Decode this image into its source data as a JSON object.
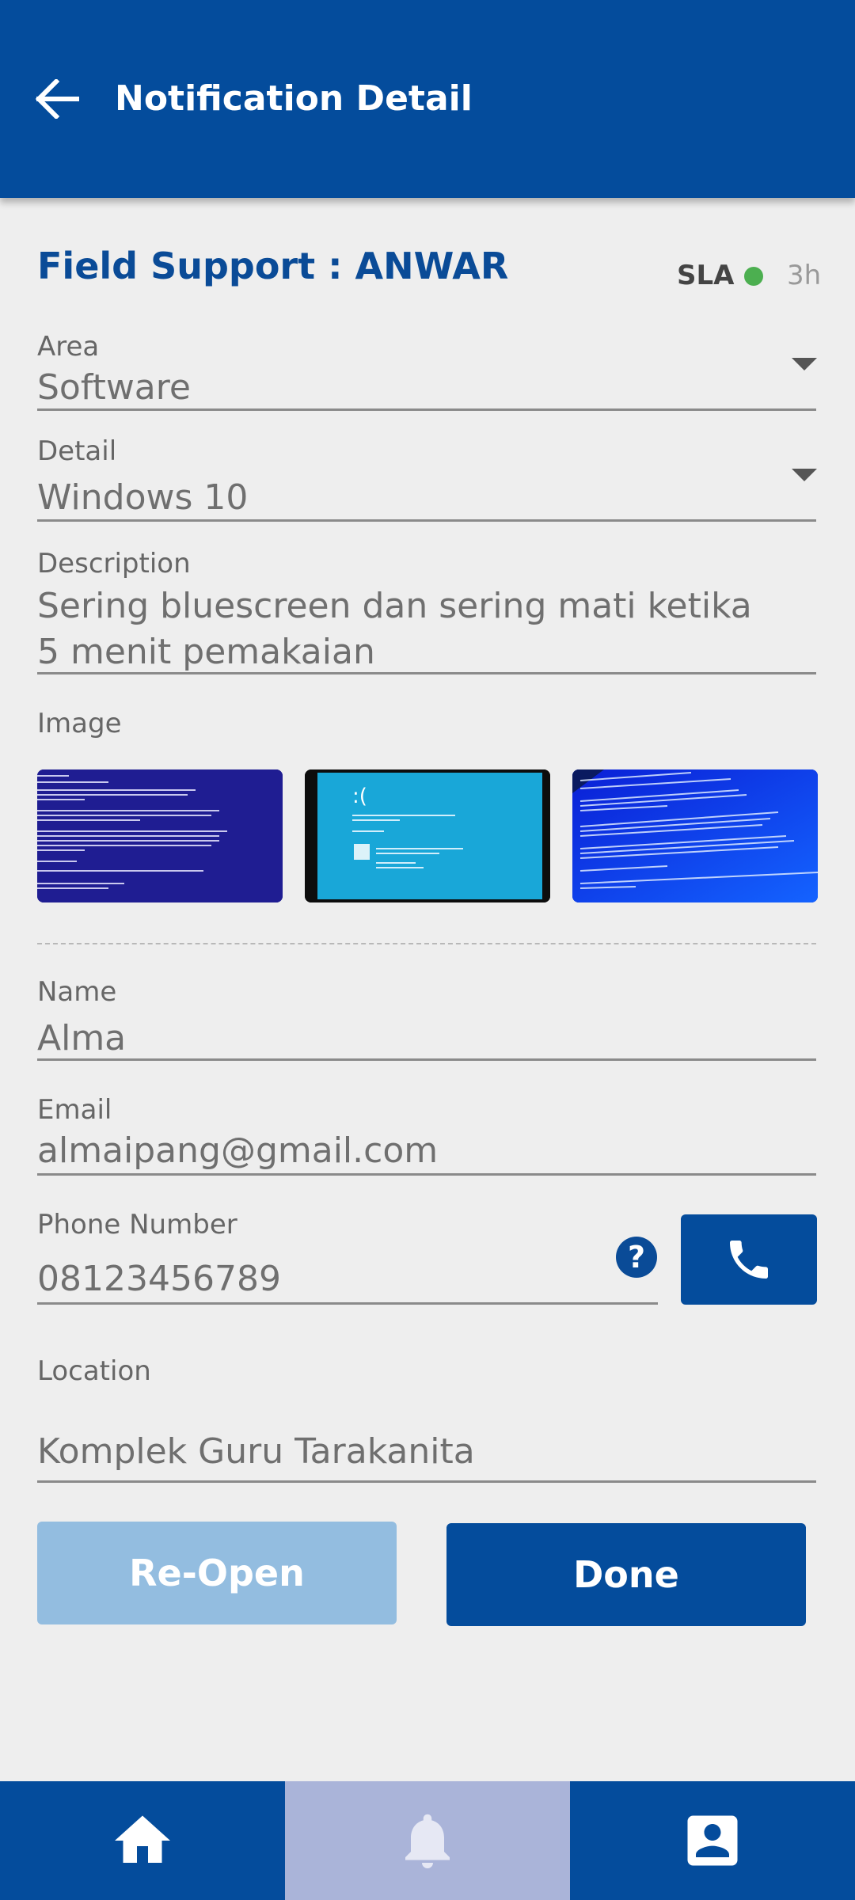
{
  "header": {
    "title": "Notification Detail",
    "back_icon": "arrow-left-icon"
  },
  "ticket": {
    "title": "Field Support : ANWAR",
    "sla_label": "SLA",
    "sla_status_color": "#4caf50",
    "sla_value": "3h"
  },
  "fields": {
    "area": {
      "label": "Area",
      "value": "Software"
    },
    "detail": {
      "label": "Detail",
      "value": "Windows 10"
    },
    "description": {
      "label": "Description",
      "line1": "Sering bluescreen dan sering mati ketika",
      "line2": "5 menit pemakaian"
    },
    "image": {
      "label": "Image"
    },
    "name": {
      "label": "Name",
      "value": "Alma"
    },
    "email": {
      "label": "Email",
      "value": "almaipang@gmail.com"
    },
    "phone": {
      "label": "Phone Number",
      "value": "08123456789"
    },
    "location": {
      "label": "Location",
      "value": "Komplek Guru Tarakanita"
    }
  },
  "actions": {
    "reopen_label": "Re-Open",
    "done_label": "Done"
  },
  "bottom_nav": {
    "items": [
      {
        "icon": "home-icon",
        "active": false
      },
      {
        "icon": "bell-icon",
        "active": true
      },
      {
        "icon": "account-box-icon",
        "active": false
      }
    ]
  },
  "colors": {
    "primary": "#044c9c",
    "title_blue": "#0a4b97",
    "reopen_disabled": "#93bde0",
    "nav_active": "#aab4d9"
  }
}
